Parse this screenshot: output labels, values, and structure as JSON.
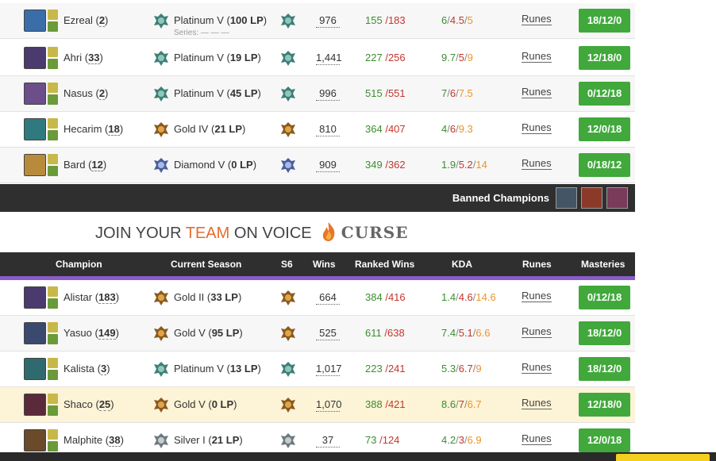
{
  "top_rows": [
    {
      "champion": "Ezreal",
      "games": "2",
      "rank": "Platinum V",
      "lp": "100 LP",
      "series": "Series: — — —",
      "wins": "976",
      "rw": "155",
      "rl": "183",
      "k": "6",
      "d": "4.5",
      "a": "5",
      "runes": "Runes",
      "masteries": "18/12/0",
      "tier": "platinum",
      "portrait": "#3b6ea8"
    },
    {
      "champion": "Ahri",
      "games": "33",
      "rank": "Platinum V",
      "lp": "19 LP",
      "wins": "1,441",
      "rw": "227",
      "rl": "256",
      "k": "9.7",
      "d": "5",
      "a": "9",
      "runes": "Runes",
      "masteries": "12/18/0",
      "tier": "platinum",
      "portrait": "#4a3a6e"
    },
    {
      "champion": "Nasus",
      "games": "2",
      "rank": "Platinum V",
      "lp": "45 LP",
      "wins": "996",
      "rw": "515",
      "rl": "551",
      "k": "7",
      "d": "6",
      "a": "7.5",
      "runes": "Runes",
      "masteries": "0/12/18",
      "tier": "platinum",
      "portrait": "#6b4e8a"
    },
    {
      "champion": "Hecarim",
      "games": "18",
      "rank": "Gold IV",
      "lp": "21 LP",
      "wins": "810",
      "rw": "364",
      "rl": "407",
      "k": "4",
      "d": "6",
      "a": "9.3",
      "runes": "Runes",
      "masteries": "12/0/18",
      "tier": "gold",
      "portrait": "#2f7a7e"
    },
    {
      "champion": "Bard",
      "games": "12",
      "rank": "Diamond V",
      "lp": "0 LP",
      "wins": "909",
      "rw": "349",
      "rl": "362",
      "k": "1.9",
      "d": "5.2",
      "a": "14",
      "runes": "Runes",
      "masteries": "0/18/12",
      "tier": "diamond",
      "portrait": "#b88a3c"
    }
  ],
  "banned": {
    "label": "Banned Champions",
    "icons": [
      "#445566",
      "#8b3a2a",
      "#7a3a5a"
    ]
  },
  "promo": {
    "pre": "JOIN YOUR ",
    "team": "TEAM",
    "post": " ON VOICE",
    "brand": "CURSE"
  },
  "columns": [
    "Champion",
    "Current Season",
    "S6",
    "Wins",
    "Ranked Wins",
    "KDA",
    "Runes",
    "Masteries"
  ],
  "bottom_rows": [
    {
      "champion": "Alistar",
      "games": "183",
      "rank": "Gold II",
      "lp": "33 LP",
      "wins": "664",
      "rw": "384",
      "rl": "416",
      "k": "1.4",
      "d": "4.6",
      "a": "14.6",
      "runes": "Runes",
      "masteries": "0/12/18",
      "tier": "gold",
      "portrait": "#4a3a6e"
    },
    {
      "champion": "Yasuo",
      "games": "149",
      "rank": "Gold V",
      "lp": "95 LP",
      "wins": "525",
      "rw": "611",
      "rl": "638",
      "k": "7.4",
      "d": "5.1",
      "a": "6.6",
      "runes": "Runes",
      "masteries": "18/12/0",
      "tier": "gold",
      "portrait": "#3a4a6e"
    },
    {
      "champion": "Kalista",
      "games": "3",
      "rank": "Platinum V",
      "lp": "13 LP",
      "wins": "1,017",
      "rw": "223",
      "rl": "241",
      "k": "5.3",
      "d": "6.7",
      "a": "9",
      "runes": "Runes",
      "masteries": "18/12/0",
      "tier": "platinum",
      "portrait": "#2f6a6e"
    },
    {
      "champion": "Shaco",
      "games": "25",
      "rank": "Gold V",
      "lp": "0 LP",
      "wins": "1,070",
      "rw": "388",
      "rl": "421",
      "k": "8.6",
      "d": "7",
      "a": "6.7",
      "runes": "Runes",
      "masteries": "12/18/0",
      "tier": "gold",
      "portrait": "#5a2a3a"
    },
    {
      "champion": "Malphite",
      "games": "38",
      "rank": "Silver I",
      "lp": "21 LP",
      "wins": "37",
      "rw": "73",
      "rl": "124",
      "k": "4.2",
      "d": "3",
      "a": "6.9",
      "runes": "Runes",
      "masteries": "12/0/18",
      "tier": "silver",
      "portrait": "#6a4a2a"
    }
  ],
  "colors": {
    "win": "#3a8f2e",
    "loss": "#c2372f",
    "assist": "#e8952c",
    "button": "#41a83c",
    "header": "#2f2f2f",
    "accent": "#8a5cc7",
    "highlight_row": "#fdf3d6"
  }
}
